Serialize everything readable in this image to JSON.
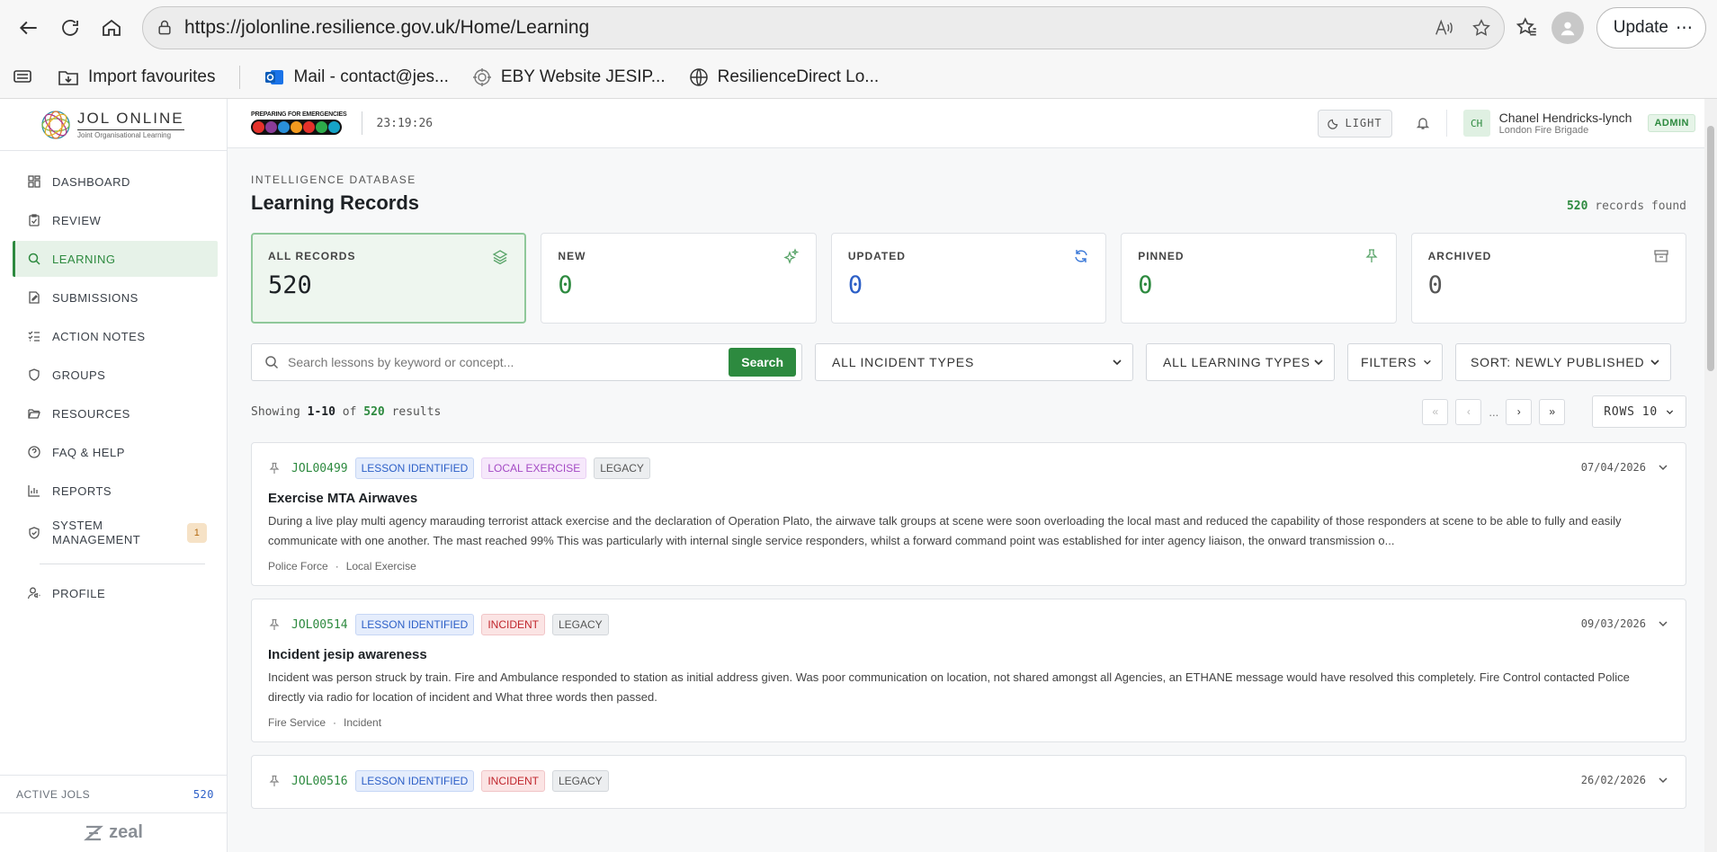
{
  "browser": {
    "url": "https://jolonline.resilience.gov.uk/Home/Learning",
    "update_label": "Update",
    "bookmarks": [
      {
        "label": "Import favourites"
      },
      {
        "label": "Mail - contact@jes..."
      },
      {
        "label": "EBY Website JESIP..."
      },
      {
        "label": "ResilienceDirect Lo..."
      }
    ]
  },
  "sidebar": {
    "logo_main": "JOL ONLINE",
    "logo_sub": "Joint Organisational Learning",
    "items": [
      {
        "label": "DASHBOARD"
      },
      {
        "label": "REVIEW"
      },
      {
        "label": "LEARNING"
      },
      {
        "label": "SUBMISSIONS"
      },
      {
        "label": "ACTION NOTES"
      },
      {
        "label": "GROUPS"
      },
      {
        "label": "RESOURCES"
      },
      {
        "label": "FAQ & HELP"
      },
      {
        "label": "REPORTS"
      },
      {
        "label": "SYSTEM MANAGEMENT",
        "badge": "1"
      },
      {
        "label": "PROFILE"
      }
    ],
    "active_jols_label": "ACTIVE JOLS",
    "active_jols_count": "520",
    "footer_brand": "zeal"
  },
  "topbar": {
    "pfe_text": "PREPARING FOR EMERGENCIES",
    "clock": "23:19:26",
    "theme_label": "LIGHT",
    "user_initials": "CH",
    "user_name": "Chanel Hendricks-lynch",
    "user_org": "London Fire Brigade",
    "role_badge": "ADMIN"
  },
  "page": {
    "eyebrow": "INTELLIGENCE DATABASE",
    "title": "Learning Records",
    "records_found_count": "520",
    "records_found_label": "records found"
  },
  "stats": [
    {
      "label": "ALL RECORDS",
      "value": "520",
      "color": "#1d2125"
    },
    {
      "label": "NEW",
      "value": "0",
      "color": "#2d8a3f"
    },
    {
      "label": "UPDATED",
      "value": "0",
      "color": "#2c5fc7"
    },
    {
      "label": "PINNED",
      "value": "0",
      "color": "#2d8a3f"
    },
    {
      "label": "ARCHIVED",
      "value": "0",
      "color": "#555555"
    }
  ],
  "filters": {
    "search_placeholder": "Search lessons by keyword or concept...",
    "search_button": "Search",
    "incident_types": "ALL INCIDENT TYPES",
    "learning_types": "ALL LEARNING TYPES",
    "filters_label": "FILTERS",
    "sort_label": "SORT: NEWLY PUBLISHED"
  },
  "results": {
    "showing_prefix": "Showing",
    "range": "1-10",
    "of": "of",
    "total": "520",
    "suffix": "results",
    "ellipsis": "...",
    "rows_label": "ROWS",
    "rows_value": "10"
  },
  "records": [
    {
      "id": "JOL00499",
      "tags": [
        {
          "label": "LESSON IDENTIFIED",
          "kind": "blue"
        },
        {
          "label": "LOCAL EXERCISE",
          "kind": "purple"
        },
        {
          "label": "LEGACY",
          "kind": "gray"
        }
      ],
      "date": "07/04/2026",
      "title": "Exercise MTA Airwaves",
      "body": "During a live play multi agency marauding terrorist attack exercise and the declaration of Operation Plato, the airwave talk groups at scene were soon overloading the local mast and reduced the capability of those responders at scene to be able to fully and easily communicate with one another. The mast reached 99% This was particularly with internal single service responders, whilst a forward command point was established for inter agency liaison, the onward transmission o...",
      "meta_org": "Police Force",
      "meta_type": "Local Exercise"
    },
    {
      "id": "JOL00514",
      "tags": [
        {
          "label": "LESSON IDENTIFIED",
          "kind": "blue"
        },
        {
          "label": "INCIDENT",
          "kind": "red"
        },
        {
          "label": "LEGACY",
          "kind": "gray"
        }
      ],
      "date": "09/03/2026",
      "title": "Incident jesip awareness",
      "body": "Incident was person struck by train. Fire and Ambulance responded to station as initial address given. Was poor communication on location, not shared amongst all Agencies,  an ETHANE message would have resolved this completely. Fire Control contacted Police directly via radio for location of incident and What three words then passed.",
      "meta_org": "Fire Service",
      "meta_type": "Incident"
    },
    {
      "id": "JOL00516",
      "tags": [
        {
          "label": "LESSON IDENTIFIED",
          "kind": "blue"
        },
        {
          "label": "INCIDENT",
          "kind": "red"
        },
        {
          "label": "LEGACY",
          "kind": "gray"
        }
      ],
      "date": "26/02/2026",
      "title": "",
      "body": "",
      "meta_org": "",
      "meta_type": ""
    }
  ],
  "meta_separator": "·"
}
